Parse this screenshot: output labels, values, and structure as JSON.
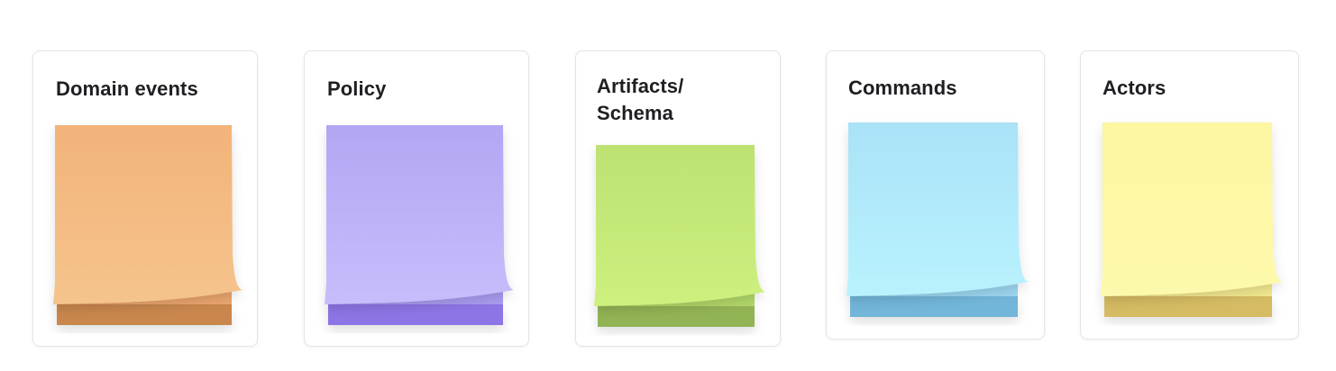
{
  "cards": [
    {
      "title": "Domain events",
      "colors": {
        "top": "#f3b37a",
        "bottom": "#f4c48c",
        "edge": "#c9874d",
        "curl": "#eba66f"
      }
    },
    {
      "title": "Policy",
      "colors": {
        "top": "#b3a6f4",
        "bottom": "#c7bdfb",
        "edge": "#8e74e6",
        "curl": "#aa9cf1"
      }
    },
    {
      "title": "Artifacts/\nSchema",
      "colors": {
        "top": "#bde272",
        "bottom": "#cdf07e",
        "edge": "#93b455",
        "curl": "#b3d86a"
      }
    },
    {
      "title": "Commands",
      "colors": {
        "top": "#aae2f8",
        "bottom": "#b9f2fd",
        "edge": "#72b6d9",
        "curl": "#9dd7f1"
      }
    },
    {
      "title": "Actors",
      "colors": {
        "top": "#fdf6a2",
        "bottom": "#fdf9ac",
        "edge": "#d5bb63",
        "curl": "#f3e990"
      }
    }
  ]
}
